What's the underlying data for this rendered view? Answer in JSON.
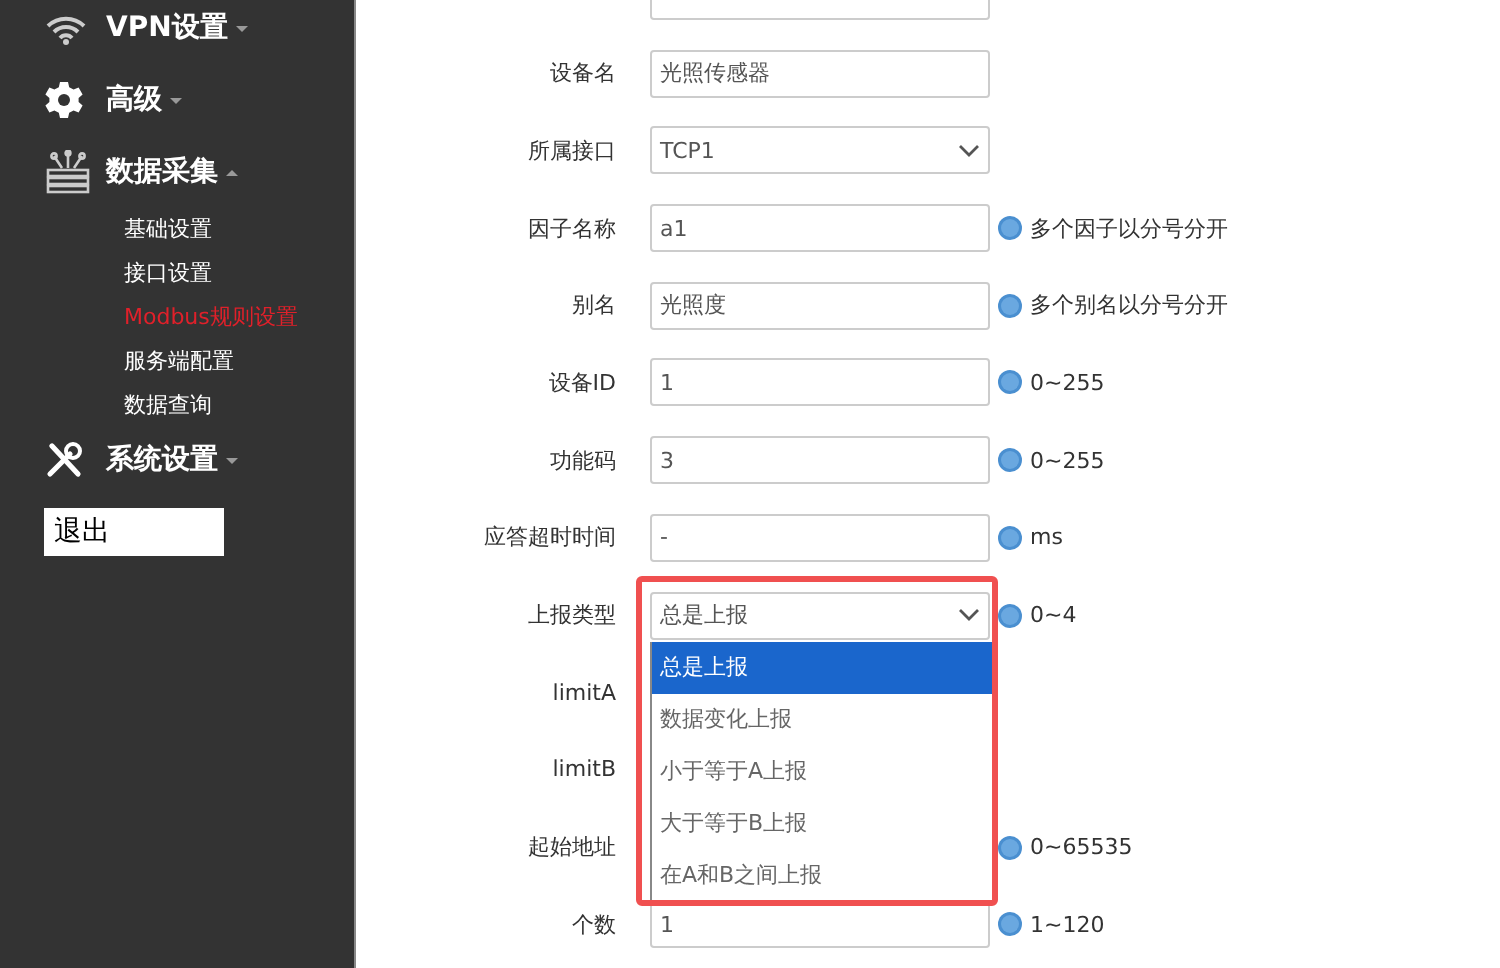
{
  "sidebar": {
    "items": [
      {
        "label": "VPN设置",
        "expanded": false
      },
      {
        "label": "高级",
        "expanded": false
      },
      {
        "label": "数据采集",
        "expanded": true,
        "children": [
          {
            "label": "基础设置",
            "selected": false
          },
          {
            "label": "接口设置",
            "selected": false
          },
          {
            "label": "Modbus规则设置",
            "selected": true
          },
          {
            "label": "服务端配置",
            "selected": false
          },
          {
            "label": "数据查询",
            "selected": false
          }
        ]
      },
      {
        "label": "系统设置",
        "expanded": false
      }
    ],
    "logout": "退出"
  },
  "form": {
    "rows": [
      {
        "kind": "partial"
      },
      {
        "kind": "input",
        "label": "设备名",
        "value": "光照传感器"
      },
      {
        "kind": "select",
        "label": "所属接口",
        "value": "TCP1"
      },
      {
        "kind": "input",
        "label": "因子名称",
        "value": "a1",
        "hint": "多个因子以分号分开"
      },
      {
        "kind": "input",
        "label": "别名",
        "value": "光照度",
        "hint": "多个别名以分号分开"
      },
      {
        "kind": "input",
        "label": "设备ID",
        "value": "1",
        "hint": "0~255"
      },
      {
        "kind": "input",
        "label": "功能码",
        "value": "3",
        "hint": "0~255"
      },
      {
        "kind": "input",
        "label": "应答超时时间",
        "value": "-",
        "hint": "ms"
      },
      {
        "kind": "select",
        "label": "上报类型",
        "value": "总是上报",
        "hint": "0~4",
        "open": true,
        "highlighted": true,
        "options": [
          {
            "label": "总是上报",
            "selected": true
          },
          {
            "label": "数据变化上报",
            "selected": false
          },
          {
            "label": "小于等于A上报",
            "selected": false
          },
          {
            "label": "大于等于B上报",
            "selected": false
          },
          {
            "label": "在A和B之间上报",
            "selected": false
          }
        ]
      },
      {
        "kind": "covered",
        "label": "limitA"
      },
      {
        "kind": "covered",
        "label": "limitB"
      },
      {
        "kind": "covered",
        "label": "起始地址",
        "hint": "0~65535"
      },
      {
        "kind": "input",
        "label": "个数",
        "value": "1",
        "hint": "1~120"
      }
    ]
  }
}
